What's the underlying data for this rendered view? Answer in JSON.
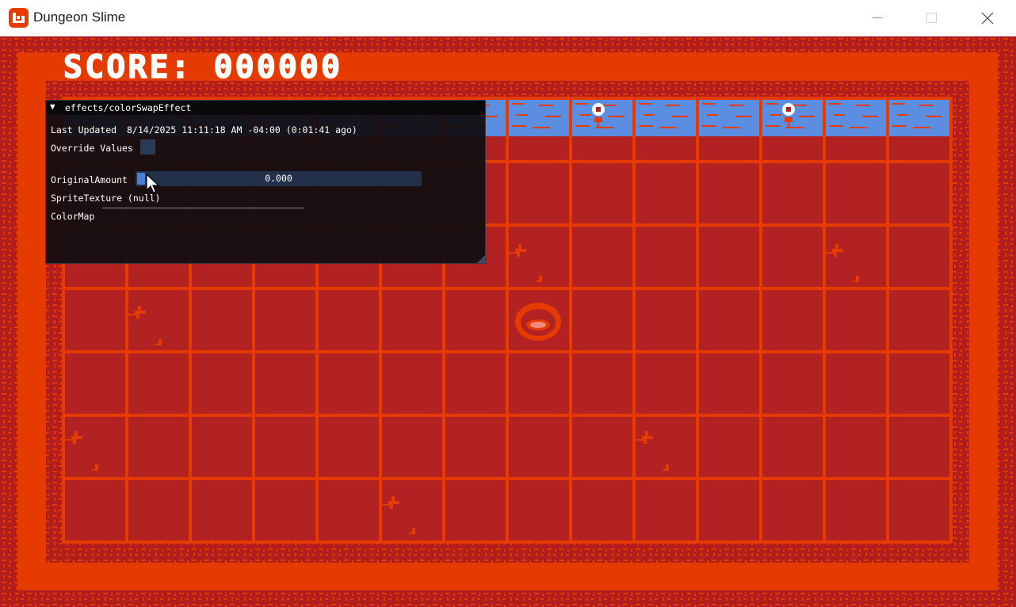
{
  "window": {
    "title": "Dungeon Slime",
    "icon": "monogame-logo-icon",
    "controls": [
      "minimize-icon",
      "maximize-icon",
      "close-icon"
    ]
  },
  "game": {
    "score_text": "SCORE: 000000",
    "colors": {
      "outer_wall": "#e53b00",
      "inner_wall": "#b21e1e",
      "floor": "#b22222",
      "grid_lines": "#e53b00",
      "water": "#5b8de0",
      "water_lines": "#e53b00",
      "slime": "#e53b00",
      "slime_eye": "#f08a80",
      "score_text": "#ffffff",
      "torch": "#ffffff"
    },
    "sprites": [
      "slime-sprite",
      "torch-icon",
      "crack-decal"
    ]
  },
  "debug_panel": {
    "title": "effects/colorSwapEffect",
    "expanded_icon": "triangle-down-icon",
    "last_updated_label": "Last Updated",
    "last_updated_value": "8/14/2025 11:11:18 AM -04:00 (0:01:41 ago)",
    "override_label": "Override Values",
    "override_checked": false,
    "original_amount_label": "OriginalAmount",
    "original_amount_value": "0.000",
    "sprite_texture_label": "SpriteTexture (null)",
    "color_map_label": "ColorMap",
    "colors": {
      "background": "#120e10",
      "title_background": "#0a0a0c",
      "frame": "#23304a",
      "slider_grab": "#4a7fd6",
      "text": "#ffffff"
    }
  }
}
